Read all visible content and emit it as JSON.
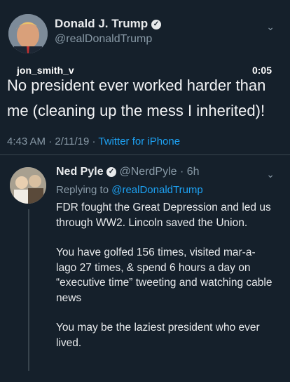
{
  "main_tweet": {
    "name": "Donald J. Trump",
    "handle": "@realDonaldTrump",
    "text": "No president ever worked harder than me (cleaning up the mess I inherited)!",
    "time": "4:43 AM · 2/11/19 · ",
    "source": "Twitter for iPhone"
  },
  "overlay": {
    "username": "jon_smith_v",
    "timestamp": "0:05"
  },
  "reply_tweet": {
    "name": "Ned Pyle",
    "handle_time": "@NerdPyle · 6h",
    "replying_label": "Replying to ",
    "replying_to": "@realDonaldTrump",
    "paragraphs": [
      "FDR fought the Great Depression  and led us through WW2. Lincoln saved the Union.",
      "You have golfed 156 times, visited mar-a-lago 27 times, & spend 6 hours a day on “executive time” tweeting and watching cable news",
      "You may be the laziest president who ever lived."
    ]
  },
  "icons": [
    "verified-icon",
    "chevron-down-icon"
  ]
}
